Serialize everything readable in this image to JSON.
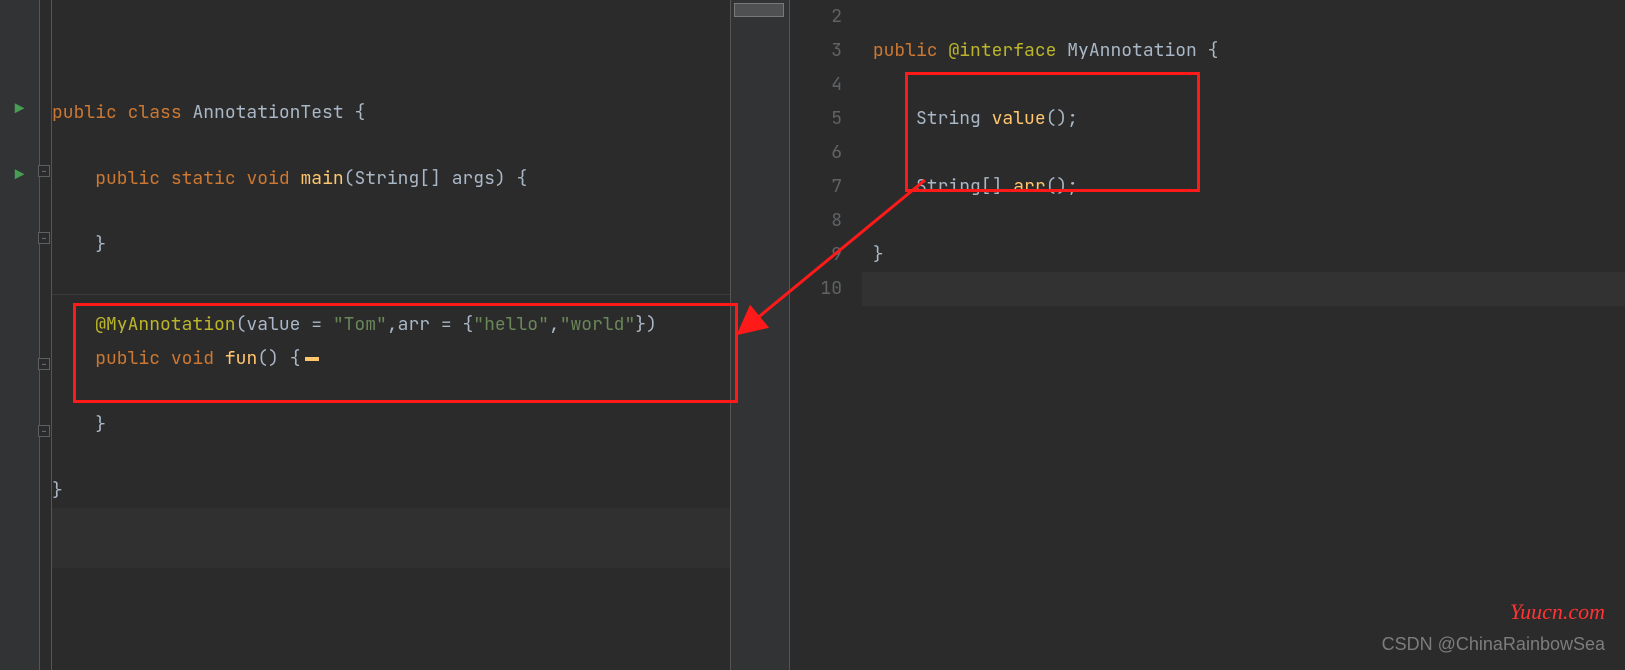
{
  "left": {
    "tokens": {
      "public": "public",
      "class": "class",
      "className": "AnnotationTest",
      "lbrace": "{",
      "rbrace": "}",
      "static": "static",
      "void": "void",
      "main": "main",
      "lparen": "(",
      "rparen": ")",
      "stringArr": "String[]",
      "args": "args",
      "annotation": "@MyAnnotation",
      "value": "value",
      "eq": " = ",
      "tom": "\"Tom\"",
      "comma": ",",
      "arr": "arr",
      "hello": "\"hello\"",
      "world": "\"world\"",
      "fun": "fun"
    }
  },
  "right": {
    "lineNumbers": [
      "2",
      "3",
      "4",
      "5",
      "6",
      "7",
      "8",
      "9",
      "10"
    ],
    "tokens": {
      "public": "public",
      "atinterface": "@interface",
      "typeName": "MyAnnotation",
      "lbrace": "{",
      "String": "String",
      "StringArr": "String[]",
      "value": "value",
      "arr": "arr",
      "parens": "()",
      "semi": ";",
      "rbrace": "}"
    }
  },
  "watermarks": {
    "site": "Yuucn.com",
    "csdn": "CSDN @ChinaRainbowSea"
  }
}
